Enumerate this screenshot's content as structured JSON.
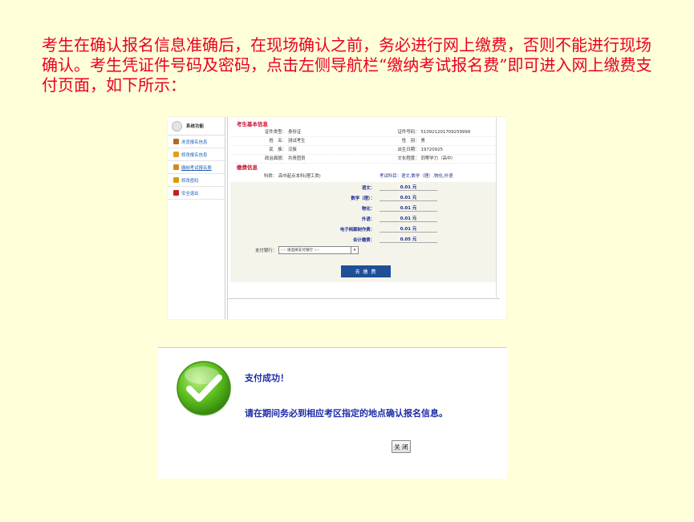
{
  "intro_text": "考生在确认报名信息准确后，在现场确认之前，务必进行网上缴费，否则不能进行现场确认。考生凭证件号码及密码，点击左侧导航栏“缴纳考试报名费”即可进入网上缴费支付页面，如下所示：",
  "sidebar": {
    "header": "系统功能",
    "items": [
      {
        "label": "浏览报名信息",
        "icon": "book-icon",
        "color": "#b06a2c"
      },
      {
        "label": "修改报名信息",
        "icon": "pencil-icon",
        "color": "#e0a020"
      },
      {
        "label": "缴纳考试报名费",
        "icon": "pen-paper-icon",
        "color": "#d28a20"
      },
      {
        "label": "修改密码",
        "icon": "key-icon",
        "color": "#d0a000"
      },
      {
        "label": "安全退出",
        "icon": "exit-icon",
        "color": "#c02020"
      }
    ]
  },
  "basic_info": {
    "title": "考生基本信息",
    "rows": [
      [
        {
          "k": "证件类型：",
          "v": "身份证"
        },
        {
          "k": "证件号码：",
          "v": "510921201709259999"
        }
      ],
      [
        {
          "k": "姓　名：",
          "v": "测试考生"
        },
        {
          "k": "性　别：",
          "v": "男"
        }
      ],
      [
        {
          "k": "民　族：",
          "v": "汉族"
        },
        {
          "k": "出生日期：",
          "v": "19720925"
        }
      ],
      [
        {
          "k": "政治面貌：",
          "v": "共青团员"
        },
        {
          "k": "文化程度：",
          "v": "同等学力（高中）"
        }
      ]
    ]
  },
  "fee_info": {
    "title": "缴费信息",
    "subject_label": "科类：",
    "subject_value": "高中起点本科(理工类)",
    "exam_subjects": "考试科目：语文,数学（理）,物化,外语",
    "fees": [
      {
        "k": "语文：",
        "v": "0.01 元"
      },
      {
        "k": "数学（理）：",
        "v": "0.01 元"
      },
      {
        "k": "物化：",
        "v": "0.01 元"
      },
      {
        "k": "外语：",
        "v": "0.01 元"
      },
      {
        "k": "电子档案制作费：",
        "v": "0.01 元"
      },
      {
        "k": "合计缴费：",
        "v": "0.05 元"
      }
    ],
    "bank_label": "支付银行：",
    "bank_placeholder": "--:: 请选择支付银行 ::--",
    "pay_button": "去 缴 费"
  },
  "success": {
    "title": "支付成功！",
    "message": "请在期间务必到相应考区指定的地点确认报名信息。",
    "close_button": "关 闭",
    "icon": "check-circle-icon",
    "icon_color": "#4caf1a"
  }
}
